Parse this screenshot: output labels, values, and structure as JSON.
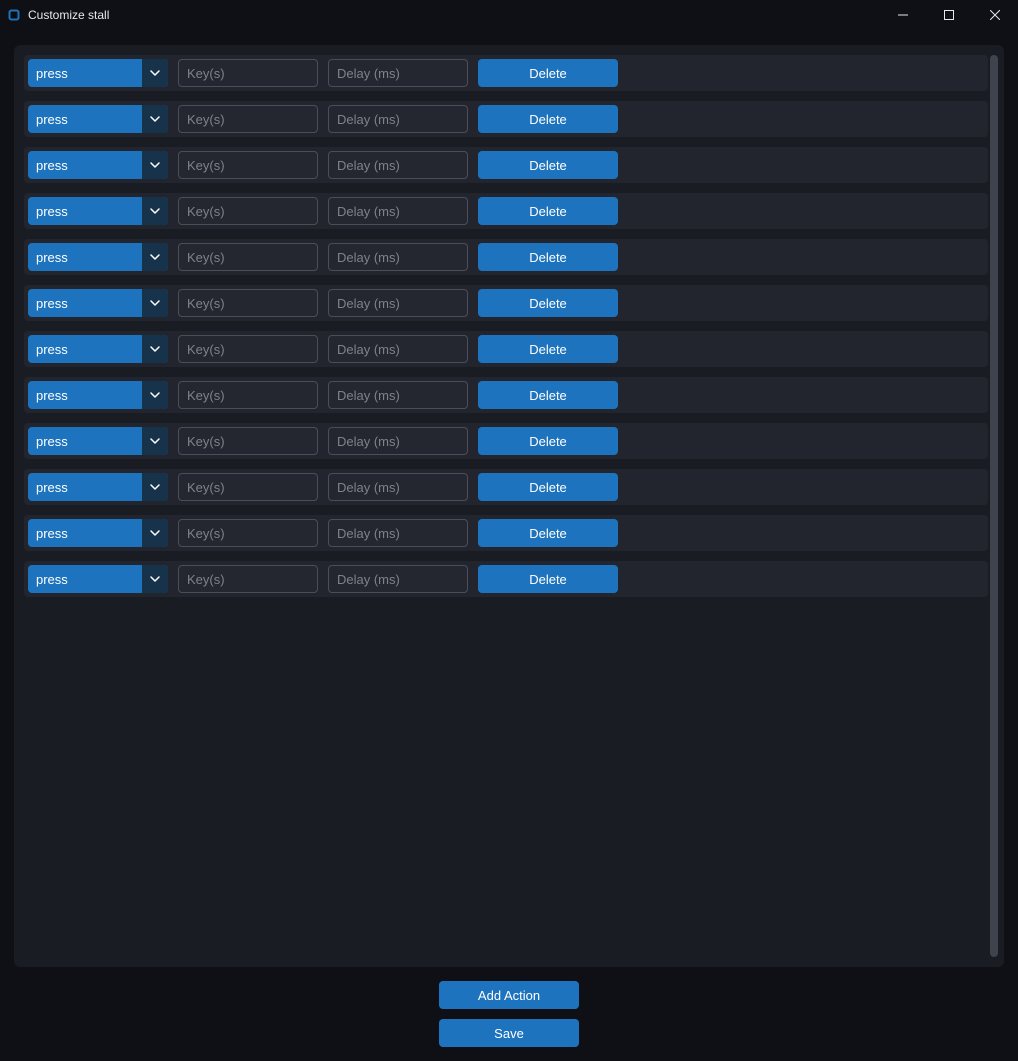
{
  "window": {
    "title": "Customize stall"
  },
  "placeholders": {
    "keys": "Key(s)",
    "delay": "Delay (ms)"
  },
  "labels": {
    "delete": "Delete",
    "add_action": "Add Action",
    "save": "Save"
  },
  "action_type_options": [
    "press"
  ],
  "actions": [
    {
      "type": "press",
      "keys": "",
      "delay": ""
    },
    {
      "type": "press",
      "keys": "",
      "delay": ""
    },
    {
      "type": "press",
      "keys": "",
      "delay": ""
    },
    {
      "type": "press",
      "keys": "",
      "delay": ""
    },
    {
      "type": "press",
      "keys": "",
      "delay": ""
    },
    {
      "type": "press",
      "keys": "",
      "delay": ""
    },
    {
      "type": "press",
      "keys": "",
      "delay": ""
    },
    {
      "type": "press",
      "keys": "",
      "delay": ""
    },
    {
      "type": "press",
      "keys": "",
      "delay": ""
    },
    {
      "type": "press",
      "keys": "",
      "delay": ""
    },
    {
      "type": "press",
      "keys": "",
      "delay": ""
    },
    {
      "type": "press",
      "keys": "",
      "delay": ""
    }
  ],
  "colors": {
    "accent": "#1d73bd",
    "panel": "#191c23",
    "row": "#22252d",
    "input_border": "#4a4e58",
    "bg": "#0e1015"
  }
}
